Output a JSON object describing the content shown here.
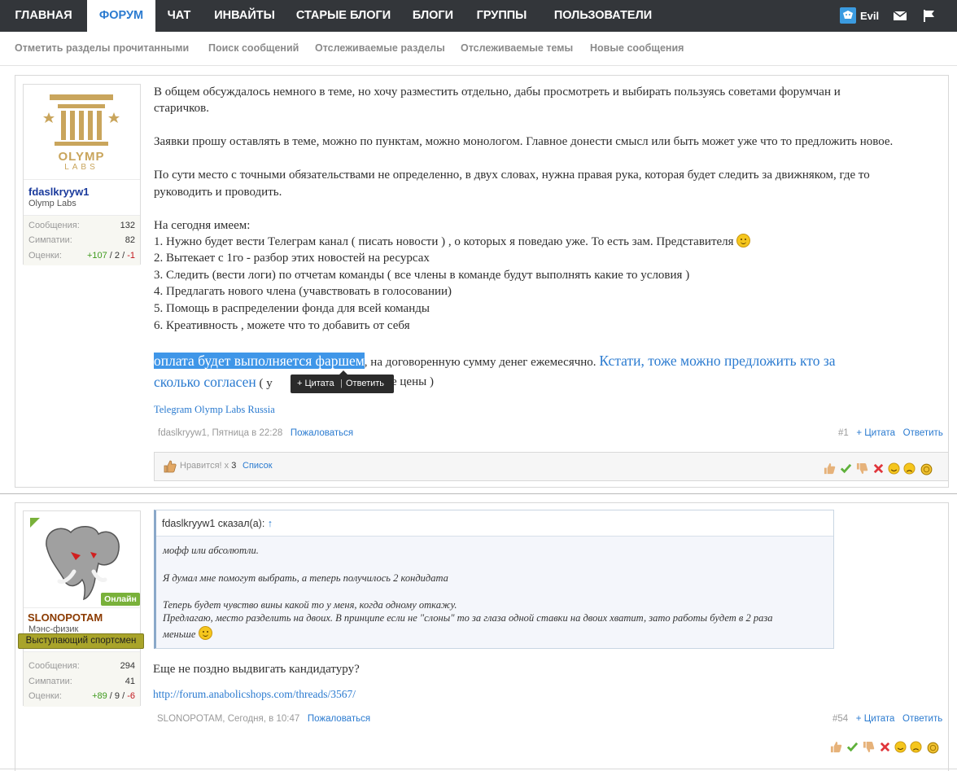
{
  "nav": {
    "tabs": [
      "ГЛАВНАЯ",
      "ФОРУМ",
      "ЧАТ",
      "ИНВАЙТЫ",
      "СТАРЫЕ БЛОГИ",
      "БЛОГИ",
      "ГРУППЫ",
      "ПОЛЬЗОВАТЕЛИ"
    ],
    "active_tab": "ФОРУМ",
    "username": "Evil",
    "sublinks": [
      "Отметить разделы прочитанными",
      "Поиск сообщений",
      "Отслеживаемые разделы",
      "Отслеживаемые темы",
      "Новые сообщения"
    ]
  },
  "colors": {
    "nav_bg": "#33363a",
    "accent": "#2b7bd0",
    "online": "#79b13a",
    "banner": "#a9a42a",
    "highlight": "#3f96e8"
  },
  "post1": {
    "author": {
      "name": "fdaslkryyw1",
      "title": "Olymp Labs",
      "logo_text_1": "OLYMP",
      "logo_text_2": "LABS",
      "stat_labels": [
        "Сообщения:",
        "Симпатии:",
        "Оценки:"
      ],
      "messages": "132",
      "likes": "82",
      "ratings_pos": "+107",
      "ratings_sep1": " / ",
      "ratings_neu": "2",
      "ratings_sep2": " / ",
      "ratings_neg": "-1"
    },
    "paragraphs": {
      "p1_l1": "В общем обсуждалось немного в теме, но хочу разместить отдельно, дабы просмотреть и выбирать пользуясь советами форумчан и",
      "p1_l2": "старичков.",
      "p2": "Заявки прошу оставлять в теме, можно по пунктам, можно монологом. Главное донести смысл или быть может уже что то предложить новое.",
      "p3_l1": "По сути место с точными обязательствами не определенно, в двух словах, нужна правая рука, которая будет следить за движняком, где то",
      "p3_l2": "руководить и проводить.",
      "list_head": "На сегодня имеем:",
      "items": [
        "1. Нужно будет вести Телеграм канал ( писать новости ) , о которых я поведаю уже. То есть зам. Представителя",
        "2. Вытекает с 1го - разбор этих новостей на ресурсах",
        "3. Следить (вести логи) по отчетам команды ( все члены в команде будут выполнять какие то условия )",
        "4. Предлагать нового члена (учавствовать в голосовании)",
        "5. Помощь в распределении фонда для всей команды",
        "6. Креативность , можете что то добавить от себя"
      ],
      "pay_highlight": "оплата будет выполняется фаршем",
      "pay_rest": ", на договоренную сумму денег ежемесячно.",
      "pay_blue_1": "Кстати, тоже можно предложить кто за",
      "pay_blue_2": "сколько согласен",
      "pay_tail_1": "( у",
      "pay_tail_2": "е цены )",
      "link": "Telegram Olymp Labs Russia"
    },
    "tooltip": {
      "quote": "+ Цитата",
      "sep": "|",
      "reply": "Ответить"
    },
    "meta": {
      "author_time": "fdaslkryyw1, Пятница в 22:28",
      "report": "Пожаловаться",
      "number": "#1",
      "quote": "+ Цитата",
      "reply": "Ответить"
    },
    "likes": {
      "text": "Нравится! x ",
      "count": "3",
      "list": "Список"
    }
  },
  "post2": {
    "author": {
      "name": "SLONOPOTAM",
      "title": "Мэнс-физик",
      "online": "Онлайн",
      "banner": "Выступающий спортсмен",
      "stat_labels": [
        "Сообщения:",
        "Симпатии:",
        "Оценки:"
      ],
      "messages": "294",
      "likes": "41",
      "ratings_pos": "+89",
      "ratings_sep1": " / ",
      "ratings_neu": "9",
      "ratings_sep2": " / ",
      "ratings_neg": "-6"
    },
    "quote": {
      "head": "fdaslkryyw1 сказал(а):",
      "arrow": "↑",
      "l1": "мофф или абсолютли.",
      "l2": "Я думал мне помогут выбрать, а теперь получилось 2 кондидата",
      "l3": "Теперь будет чувство вины какой то у меня, когда одному откажу.",
      "l4": "Предлагаю, место разделить на двоих. В принципе если не \"слоны\" то за глаза одной ставки на двоих хватит, зато работы будет в 2 раза",
      "l5": "меньше"
    },
    "text": "Еще не поздно выдвигать кандидатуру?",
    "link": "http://forum.anabolicshops.com/threads/3567/",
    "meta": {
      "author_time": "SLONOPOTAM, Сегодня, в 10:47",
      "report": "Пожаловаться",
      "number": "#54",
      "quote": "+ Цитата",
      "reply": "Ответить"
    }
  },
  "icons": [
    "mail-icon",
    "flag-icon",
    "thumbs-up-icon",
    "check-icon",
    "thumbs-down-icon",
    "x-icon",
    "smile-icon",
    "sad-icon",
    "medal-icon"
  ]
}
